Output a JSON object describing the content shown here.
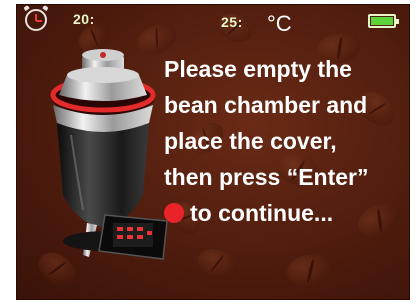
{
  "status_bar": {
    "clock_icon": "clock-icon",
    "left_value": "20:",
    "center_value": "25:",
    "unit": "°C",
    "battery_icon": "battery-full-icon",
    "battery_color": "#5cd43a"
  },
  "message": {
    "line1": "Please empty the",
    "line2": "bean chamber and",
    "line3": "place the cover,",
    "line4": "then press “Enter”",
    "line5": "to continue...",
    "enter_indicator_color": "#e8232a"
  },
  "illustration": {
    "icon": "coffee-roaster-machine-icon"
  },
  "colors": {
    "background": "#4e1c0d",
    "text": "#ffffff"
  }
}
